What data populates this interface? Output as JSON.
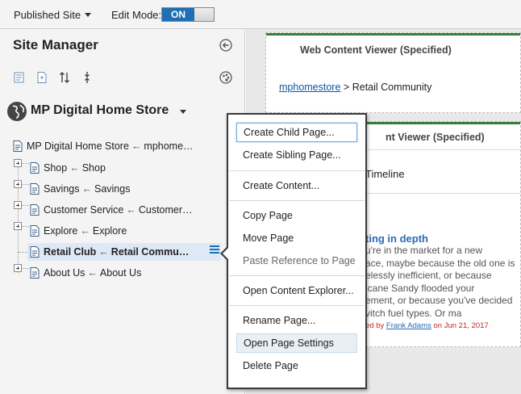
{
  "topbar": {
    "published_label": "Published Site",
    "edit_mode_label": "Edit Mode:",
    "toggle_on_label": "ON"
  },
  "site_manager": {
    "title": "Site Manager",
    "site_name": "MP Digital Home Store",
    "tree": [
      {
        "label": "MP Digital Home Store",
        "arrow": "←",
        "target": "mphome…"
      },
      {
        "label": "Shop",
        "arrow": "←",
        "target": "Shop"
      },
      {
        "label": "Savings",
        "arrow": "←",
        "target": "Savings"
      },
      {
        "label": "Customer Service",
        "arrow": "←",
        "target": "Customer…"
      },
      {
        "label": "Explore",
        "arrow": "←",
        "target": "Explore"
      },
      {
        "label": "Retail Club",
        "arrow": "←",
        "target": "Retail Commu…"
      },
      {
        "label": "About Us",
        "arrow": "←",
        "target": "About Us"
      }
    ]
  },
  "content": {
    "portlet1_title": "Web Content Viewer (Specified)",
    "breadcrumb_link": "mphomestore",
    "breadcrumb_sep": ">",
    "breadcrumb_current": "Retail Community",
    "portlet2_title": "nt Viewer (Specified)",
    "timeline": "Timeline",
    "article_title": "ting in depth",
    "article_lines": [
      "u're in the market for a new",
      "ace, maybe because the old one is",
      "elessly inefficient, or because",
      "icane Sandy flooded your",
      "ement, or because you've decided",
      "vitch fuel types. Or ma"
    ],
    "byline_prefix": "ed by",
    "byline_author": "Frank Adams",
    "byline_date": "on Jun 21, 2017"
  },
  "context_menu": {
    "items": [
      "Create Child Page...",
      "Create Sibling Page...",
      "Create Content...",
      "Copy Page",
      "Move Page",
      "Paste Reference to Page",
      "Open Content Explorer...",
      "Rename Page...",
      "Open Page Settings",
      "Delete Page"
    ]
  },
  "colors": {
    "accent_blue": "#1e6fb3",
    "portlet_green": "#3b7d3c",
    "link_blue": "#0a58a6",
    "byline_red": "#cc2222"
  }
}
